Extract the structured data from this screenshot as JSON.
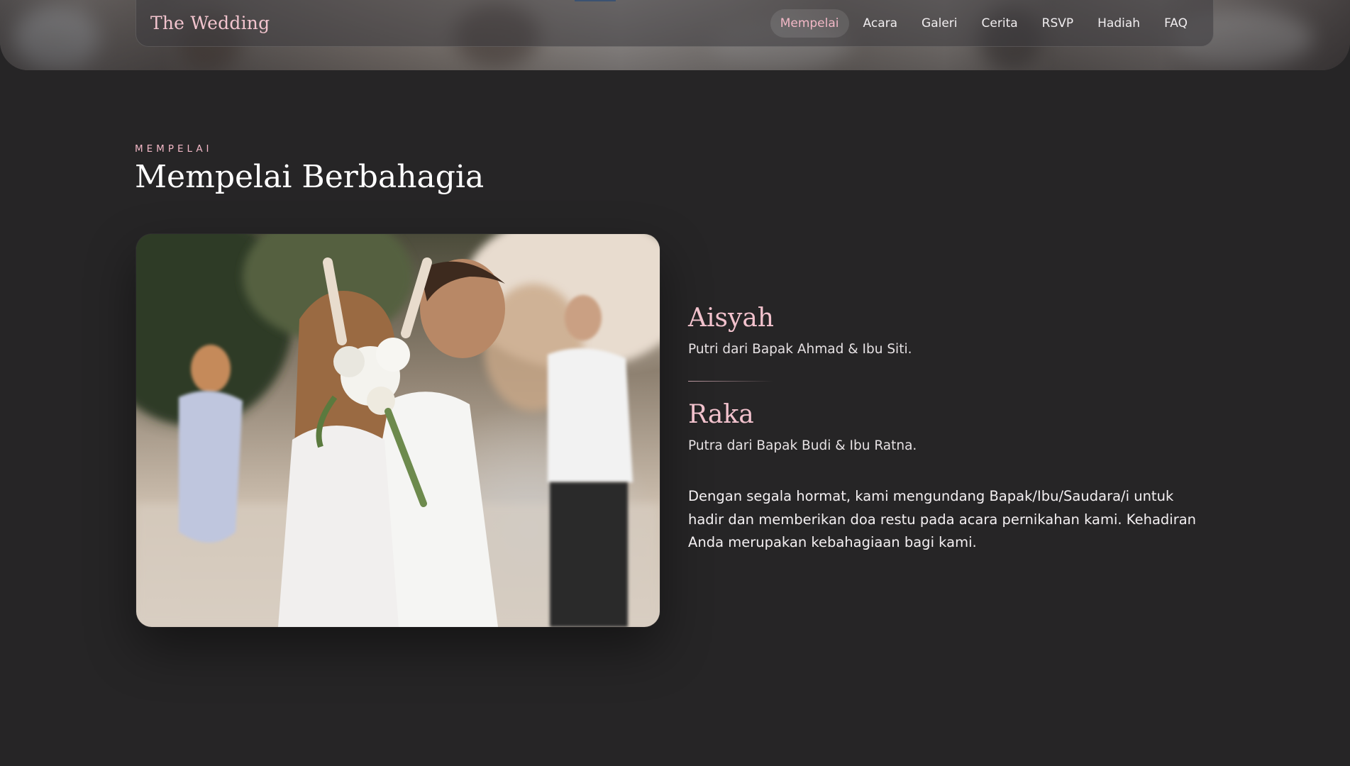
{
  "header": {
    "brand": "The Wedding",
    "nav": [
      {
        "label": "Mempelai",
        "active": true
      },
      {
        "label": "Acara"
      },
      {
        "label": "Galeri"
      },
      {
        "label": "Cerita"
      },
      {
        "label": "RSVP"
      },
      {
        "label": "Hadiah"
      },
      {
        "label": "FAQ"
      }
    ]
  },
  "section": {
    "eyebrow": "MEMPELAI",
    "title": "Mempelai Berbahagia",
    "photo": {
      "icon": "couple-photo"
    },
    "bride": {
      "name": "Aisyah",
      "parents": "Putri dari Bapak Ahmad & Ibu Siti."
    },
    "groom": {
      "name": "Raka",
      "parents": "Putra dari Bapak Budi & Ibu Ratna."
    },
    "invitation": "Dengan segala hormat, kami mengundang Bapak/Ibu/Saudara/i untuk hadir dan memberikan doa restu pada acara pernikahan kami. Kehadiran Anda merupakan kebahagiaan bagi kami."
  },
  "colors": {
    "background": "#262526",
    "accent_pink": "#f2c2cd",
    "text": "#f3eef0"
  }
}
